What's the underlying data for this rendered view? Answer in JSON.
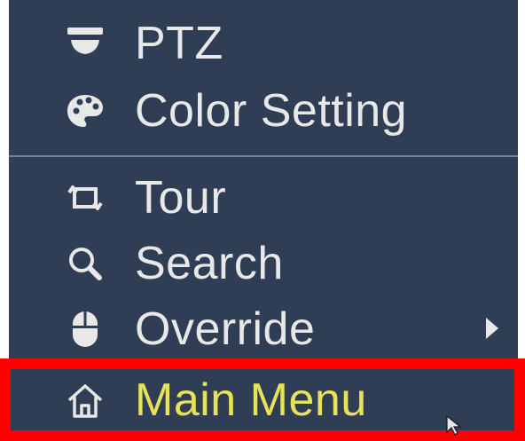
{
  "menu": {
    "items": [
      {
        "label": "PTZ",
        "icon": "ptz-camera-icon"
      },
      {
        "label": "Color Setting",
        "icon": "palette-icon"
      },
      {
        "label": "Tour",
        "icon": "tour-icon"
      },
      {
        "label": "Search",
        "icon": "search-icon"
      },
      {
        "label": "Override",
        "icon": "mouse-icon",
        "has_submenu": true
      },
      {
        "label": "Main Menu",
        "icon": "home-icon",
        "highlighted": true
      }
    ]
  },
  "colors": {
    "panel_bg": "#2f3d55",
    "text": "#e8e8e8",
    "highlight_text": "#e7e25a",
    "highlight_border": "#ff0000",
    "divider": "#6f8aa8"
  }
}
